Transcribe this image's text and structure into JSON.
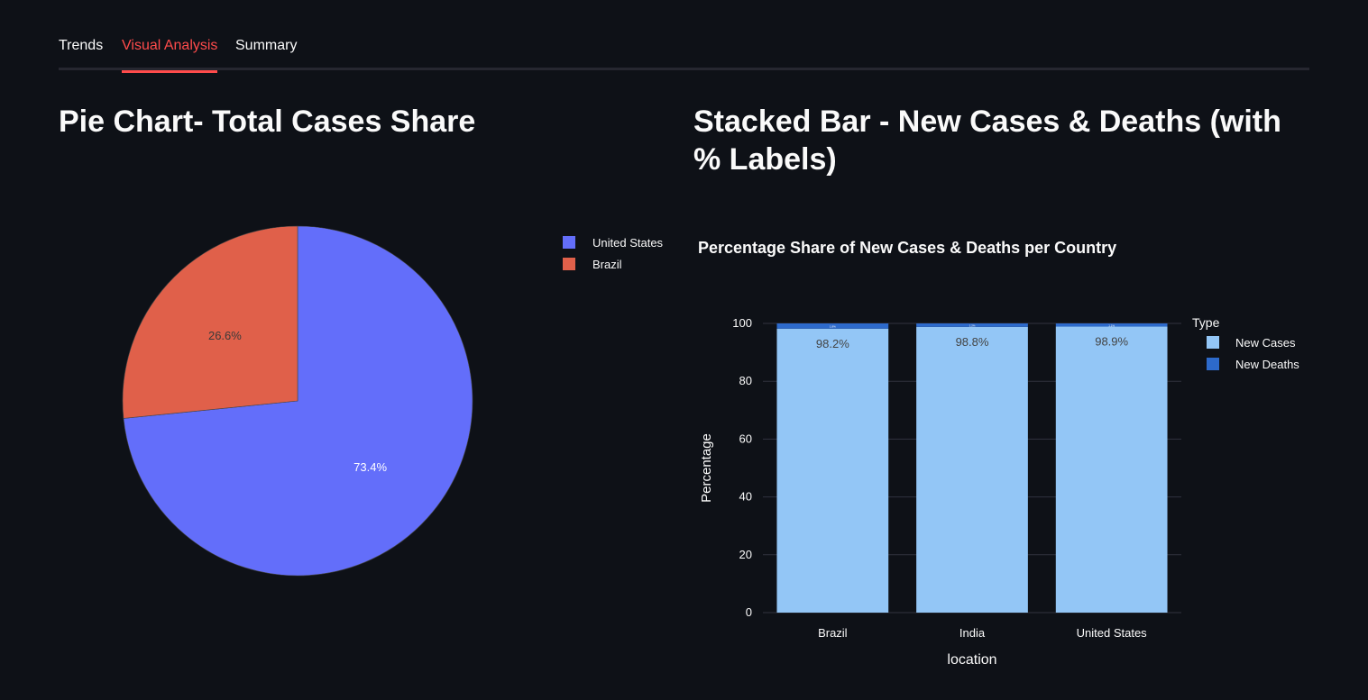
{
  "tabs": [
    {
      "label": "Trends",
      "active": false
    },
    {
      "label": "Visual Analysis",
      "active": true
    },
    {
      "label": "Summary",
      "active": false
    }
  ],
  "colors": {
    "background": "#0e1117",
    "accent": "#ff4b4b",
    "text": "#fafafa",
    "pie_united_states": "#636efa",
    "pie_brazil": "#e0604a",
    "bar_new_cases": "#93c6f6",
    "bar_new_deaths": "#2d6acb"
  },
  "pie_section": {
    "heading": "Pie Chart- Total Cases Share"
  },
  "bar_section": {
    "heading": "Stacked Bar - New Cases & Deaths (with % Labels)"
  },
  "chart_data": [
    {
      "type": "pie",
      "title": "",
      "slices": [
        {
          "label": "United States",
          "value": 73.4,
          "display": "73.4%"
        },
        {
          "label": "Brazil",
          "value": 26.6,
          "display": "26.6%"
        }
      ],
      "legend": [
        "United States",
        "Brazil"
      ],
      "legend_position": "right"
    },
    {
      "type": "bar",
      "stacked": true,
      "title": "Percentage Share of New Cases & Deaths per Country",
      "xlabel": "location",
      "ylabel": "Percentage",
      "categories": [
        "Brazil",
        "India",
        "United States"
      ],
      "series": [
        {
          "name": "New Cases",
          "values": [
            98.2,
            98.8,
            98.9
          ],
          "labels": [
            "98.2%",
            "98.8%",
            "98.9%"
          ]
        },
        {
          "name": "New Deaths",
          "values": [
            1.8,
            1.2,
            1.1
          ],
          "labels": [
            "1.8%",
            "1.2%",
            "1.1%"
          ]
        }
      ],
      "ylim": [
        0,
        100
      ],
      "yticks": [
        0,
        20,
        40,
        60,
        80,
        100
      ],
      "legend_title": "Type",
      "legend_position": "top-right",
      "grid": true
    }
  ]
}
